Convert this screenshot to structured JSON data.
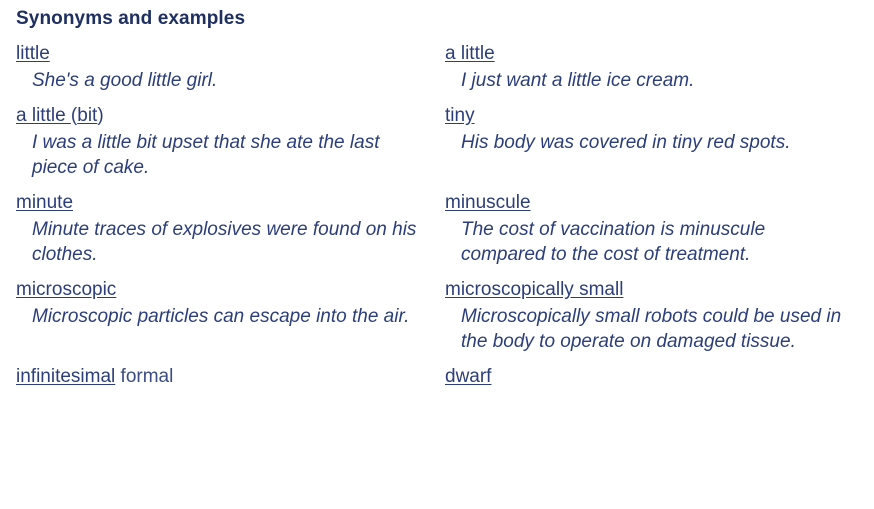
{
  "section": {
    "title": "Synonyms and examples",
    "accent_color": "#2c3e7a",
    "heading_color": "#1e2f60",
    "background_color": "#ffffff"
  },
  "rows": [
    {
      "left": {
        "headword_parts": [
          {
            "text": "little",
            "underlined": true
          }
        ],
        "register": "",
        "example": "She's a good little girl."
      },
      "right": {
        "headword_parts": [
          {
            "text": "a little",
            "underlined": true
          }
        ],
        "register": "",
        "example": "I just want a little ice cream."
      }
    },
    {
      "left": {
        "headword_parts": [
          {
            "text": "a little ",
            "underlined": true
          },
          {
            "text": "(",
            "underlined": false
          },
          {
            "text": "bit",
            "underlined": true
          },
          {
            "text": ")",
            "underlined": false
          }
        ],
        "register": "",
        "example": "I was a little bit upset that she ate the last piece of cake."
      },
      "right": {
        "headword_parts": [
          {
            "text": "tiny",
            "underlined": true
          }
        ],
        "register": "",
        "example": "His body was covered in tiny red spots."
      }
    },
    {
      "left": {
        "headword_parts": [
          {
            "text": "minute",
            "underlined": true
          }
        ],
        "register": "",
        "example": "Minute traces of explosives were found on his clothes."
      },
      "right": {
        "headword_parts": [
          {
            "text": "minuscule",
            "underlined": true
          }
        ],
        "register": "",
        "example": "The cost of vaccination is minuscule compared to the cost of treatment."
      }
    },
    {
      "left": {
        "headword_parts": [
          {
            "text": "microscopic",
            "underlined": true
          }
        ],
        "register": "",
        "example": "Microscopic particles can escape into the air."
      },
      "right": {
        "headword_parts": [
          {
            "text": "microscopically small",
            "underlined": true
          }
        ],
        "register": "",
        "example": "Microscopically small robots could be used in the body to operate on damaged tissue."
      }
    },
    {
      "left": {
        "headword_parts": [
          {
            "text": "infinitesimal",
            "underlined": true
          }
        ],
        "register": "formal",
        "example": ""
      },
      "right": {
        "headword_parts": [
          {
            "text": "dwarf",
            "underlined": true
          }
        ],
        "register": "",
        "example": ""
      }
    }
  ]
}
